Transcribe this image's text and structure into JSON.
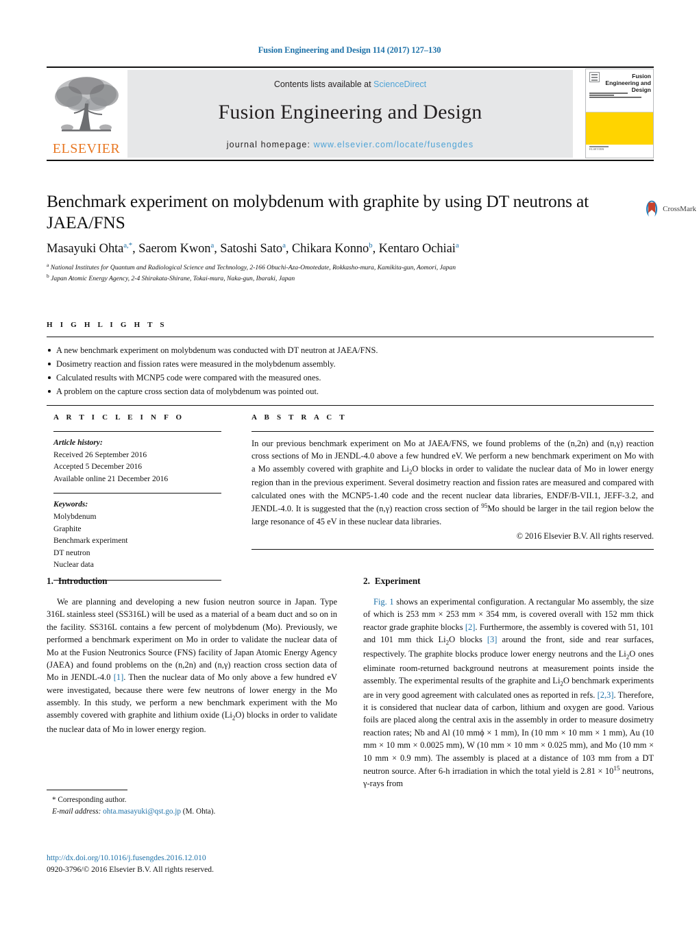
{
  "running_head": "Fusion Engineering and Design 114 (2017) 127–130",
  "masthead": {
    "publisher_logo_text": "ELSEVIER",
    "contents_prefix": "Contents lists available at ",
    "contents_link": "ScienceDirect",
    "journal_title": "Fusion Engineering and Design",
    "homepage_prefix": "journal homepage: ",
    "homepage_url": "www.elsevier.com/locate/fusengdes",
    "cover": {
      "title": "Fusion Engineering and Design",
      "accent_color": "#ffd400",
      "publisher": "ELSEVIER"
    }
  },
  "article": {
    "title": "Benchmark experiment on molybdenum with graphite by using DT neutrons at JAEA/FNS",
    "crossmark_label": "CrossMark",
    "authors_html": "Masayuki Ohta<sup>a,*</sup>, Saerom Kwon<sup>a</sup>, Satoshi Sato<sup>a</sup>, Chikara Konno<sup>b</sup>, Kentaro Ochiai<sup>a</sup>",
    "affiliations": [
      "a National Institutes for Quantum and Radiological Science and Technology, 2-166 Obuchi-Aza-Omotedate, Rokkasho-mura, Kamikita-gun, Aomori, Japan",
      "b Japan Atomic Energy Agency, 2-4 Shirakata-Shirane, Tokai-mura, Naka-gun, Ibaraki, Japan"
    ]
  },
  "highlights": {
    "heading": "H I G H L I G H T S",
    "items": [
      "A new benchmark experiment on molybdenum was conducted with DT neutron at JAEA/FNS.",
      "Dosimetry reaction and fission rates were measured in the molybdenum assembly.",
      "Calculated results with MCNP5 code were compared with the measured ones.",
      "A problem on the capture cross section data of molybdenum was pointed out."
    ]
  },
  "article_info": {
    "heading": "A R T I C L E   I N F O",
    "history_label": "Article history:",
    "history": [
      "Received 26 September 2016",
      "Accepted 5 December 2016",
      "Available online 21 December 2016"
    ],
    "keywords_label": "Keywords:",
    "keywords": [
      "Molybdenum",
      "Graphite",
      "Benchmark experiment",
      "DT neutron",
      "Nuclear data"
    ]
  },
  "abstract": {
    "heading": "A B S T R A C T",
    "text": "In our previous benchmark experiment on Mo at JAEA/FNS, we found problems of the (n,2n) and (n,γ) reaction cross sections of Mo in JENDL-4.0 above a few hundred eV. We perform a new benchmark experiment on Mo with a Mo assembly covered with graphite and Li2O blocks in order to validate the nuclear data of Mo in lower energy region than in the previous experiment. Several dosimetry reaction and fission rates are measured and compared with calculated ones with the MCNP5-1.40 code and the recent nuclear data libraries, ENDF/B-VII.1, JEFF-3.2, and JENDL-4.0. It is suggested that the (n,γ) reaction cross section of 95Mo should be larger in the tail region below the large resonance of 45 eV in these nuclear data libraries.",
    "copyright": "© 2016 Elsevier B.V. All rights reserved."
  },
  "sections": {
    "introduction": {
      "number": "1.",
      "title": "Introduction",
      "paragraph": "We are planning and developing a new fusion neutron source in Japan. Type 316L stainless steel (SS316L) will be used as a material of a beam duct and so on in the facility. SS316L contains a few percent of molybdenum (Mo). Previously, we performed a benchmark experiment on Mo in order to validate the nuclear data of Mo at the Fusion Neutronics Source (FNS) facility of Japan Atomic Energy Agency (JAEA) and found problems on the (n,2n) and (n,γ) reaction cross section data of Mo in JENDL-4.0 [1]. Then the nuclear data of Mo only above a few hundred eV were investigated, because there were few neutrons of lower energy in the Mo assembly. In this study, we perform a new benchmark experiment with the Mo assembly covered with graphite and lithium oxide (Li2O) blocks in order to validate the nuclear data of Mo in lower energy region."
    },
    "experiment": {
      "number": "2.",
      "title": "Experiment",
      "paragraph": "Fig. 1 shows an experimental configuration. A rectangular Mo assembly, the size of which is 253 mm × 253 mm × 354 mm, is covered overall with 152 mm thick reactor grade graphite blocks [2]. Furthermore, the assembly is covered with 51, 101 and 101 mm thick Li2O blocks [3] around the front, side and rear surfaces, respectively. The graphite blocks produce lower energy neutrons and the Li2O ones eliminate room-returned background neutrons at measurement points inside the assembly. The experimental results of the graphite and Li2O benchmark experiments are in very good agreement with calculated ones as reported in refs. [2,3]. Therefore, it is considered that nuclear data of carbon, lithium and oxygen are good. Various foils are placed along the central axis in the assembly in order to measure dosimetry reaction rates; Nb and Al (10 mmϕ × 1 mm), In (10 mm × 10 mm × 1 mm), Au (10 mm × 10 mm × 0.0025 mm), W (10 mm × 10 mm × 0.025 mm), and Mo (10 mm × 10 mm × 0.9 mm). The assembly is placed at a distance of 103 mm from a DT neutron source. After 6-h irradiation in which the total yield is 2.81 × 10^15 neutrons, γ-rays from"
    }
  },
  "footnote": {
    "corresponding": "* Corresponding author.",
    "email_label": "E-mail address:",
    "email": "ohta.masayuki@qst.go.jp",
    "email_suffix": "(M. Ohta)."
  },
  "footer": {
    "doi": "http://dx.doi.org/10.1016/j.fusengdes.2016.12.010",
    "issn_line": "0920-3796/© 2016 Elsevier B.V. All rights reserved."
  },
  "colors": {
    "link": "#1d71a8",
    "light_link": "#4ea3d6",
    "elsevier_orange": "#e87722",
    "cover_yellow": "#ffd400",
    "band_grey": "#e6e7e8"
  }
}
